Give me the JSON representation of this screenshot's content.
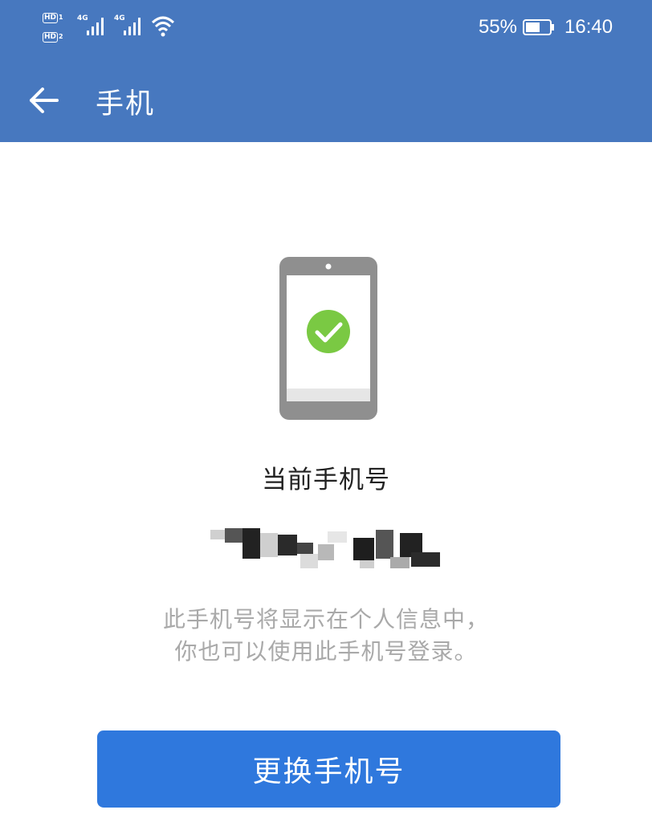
{
  "status_bar": {
    "sim1_hd": "HD",
    "sim1_num": "1",
    "sim2_hd": "HD",
    "sim2_num": "2",
    "sim1_network": "4G",
    "sim2_network": "4G",
    "battery": "55%",
    "time": "16:40",
    "icons": [
      "signal-icon",
      "wifi-icon",
      "battery-icon"
    ]
  },
  "header": {
    "title": "手机",
    "back_icon": "back-arrow-icon",
    "background_color": "#4778bf"
  },
  "main": {
    "illustration_icon": "phone-check-icon",
    "check_color": "#7ac943",
    "current_label": "当前手机号",
    "hint_line1": "此手机号将显示在个人信息中，",
    "hint_line2": "你也可以使用此手机号登录。"
  },
  "actions": {
    "change_label": "更换手机号",
    "button_color": "#2f78dd"
  }
}
